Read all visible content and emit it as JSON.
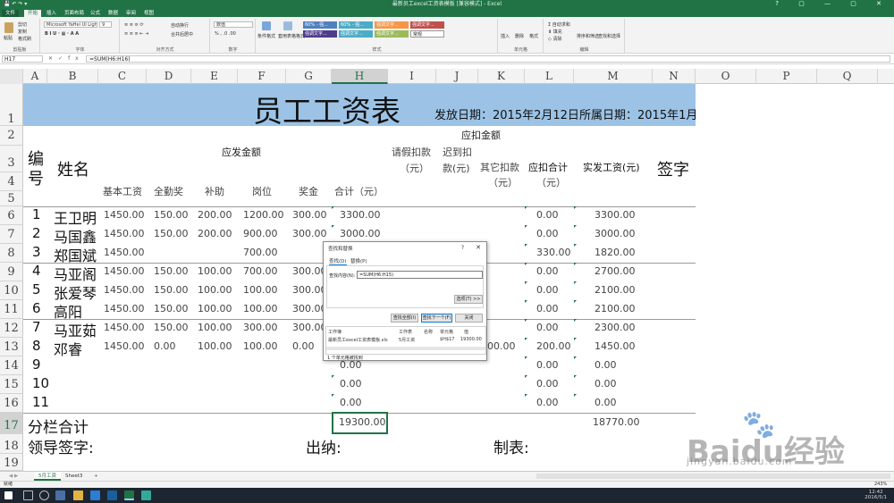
{
  "window": {
    "title": "最新员工excel工资表模板 [兼容模式] - Excel",
    "controls": "? ▢ — ▢ ✕"
  },
  "ribbon_tabs": [
    "文件",
    "开始",
    "插入",
    "页面布局",
    "公式",
    "数据",
    "审阅",
    "视图"
  ],
  "ribbon": {
    "clipboard": {
      "cut": "剪切",
      "copy": "复制",
      "paint": "格式刷",
      "paste": "粘贴",
      "label": "剪贴板"
    },
    "font": {
      "name": "Microsoft YaHei UI Ligh",
      "size": "9",
      "label": "字体"
    },
    "align": {
      "wrap": "自动换行",
      "merge": "合并后居中",
      "label": "对齐方式"
    },
    "number": {
      "format": "数值",
      "label": "数字"
    },
    "styles": {
      "cond": "条件格式",
      "table": "套用表格格式",
      "items": [
        {
          "text": "60% - 强...",
          "color": "#4f81bd"
        },
        {
          "text": "60% - 强...",
          "color": "#4bacc6"
        },
        {
          "text": "强调文字...",
          "color": "#f79646"
        },
        {
          "text": "强调文字...",
          "color": "#c0504d"
        },
        {
          "text": "强调文字...",
          "color": "#4f3d8c"
        },
        {
          "text": "强调文字...",
          "color": "#8064a2"
        },
        {
          "text": "强调文字...",
          "color": "#4bacc6"
        },
        {
          "text": "强调文字...",
          "color": "#9bbb59"
        },
        {
          "text": "强调文字...",
          "color": "#8064a2"
        },
        {
          "text": "常规",
          "color": "#ffffff"
        }
      ],
      "label": "样式"
    },
    "cells": {
      "insert": "插入",
      "delete": "删除",
      "format": "格式",
      "label": "单元格"
    },
    "edit": {
      "autosum": "自动求和",
      "fill": "填充",
      "clear": "清除",
      "sort": "排序和筛选",
      "find": "查找和选择",
      "label": "编辑"
    }
  },
  "formula_bar": {
    "name_box": "H17",
    "fx": "fx",
    "formula": "=SUM(H6:H16)"
  },
  "columns": [
    "A",
    "B",
    "C",
    "D",
    "E",
    "F",
    "G",
    "H",
    "I",
    "J",
    "K",
    "L",
    "M",
    "N",
    "O",
    "P",
    "Q"
  ],
  "rows": [
    "1",
    "2",
    "3",
    "4",
    "5",
    "6",
    "7",
    "8",
    "9",
    "10",
    "11",
    "12",
    "13",
    "14",
    "15",
    "16",
    "17",
    "18",
    "19"
  ],
  "sheet": {
    "title": "员工工资表",
    "issue_date": "发放日期：2015年2月12日",
    "period": "所属日期：2015年1月",
    "group_pay": "应发金额",
    "group_deduct": "应扣金额",
    "h_id": [
      "编",
      "号"
    ],
    "h_name": "姓名",
    "h_base": "基本工资",
    "h_attend": "全勤奖",
    "h_subsidy": "补助",
    "h_post": "岗位",
    "h_bonus": "奖金",
    "h_total": "合计（元）",
    "h_leave": [
      "请假扣款",
      "（元）"
    ],
    "h_late": [
      "迟到扣",
      "款(元)"
    ],
    "h_other": [
      "其它扣款",
      "（元）"
    ],
    "h_deduct": [
      "应扣合计",
      "（元）"
    ],
    "h_net": "实发工资(元)",
    "h_sign": "签字",
    "data": [
      {
        "id": "1",
        "name": "王卫明",
        "base": "1450.00",
        "attend": "150.00",
        "subsidy": "200.00",
        "post": "1200.00",
        "bonus": "300.00",
        "total": "3300.00",
        "other": "",
        "deduct": "0.00",
        "net": "3300.00"
      },
      {
        "id": "2",
        "name": "马国鑫",
        "base": "1450.00",
        "attend": "150.00",
        "subsidy": "200.00",
        "post": "900.00",
        "bonus": "300.00",
        "total": "3000.00",
        "other": "",
        "deduct": "0.00",
        "net": "3000.00"
      },
      {
        "id": "3",
        "name": "郑国斌",
        "base": "1450.00",
        "attend": "",
        "subsidy": "",
        "post": "700.00",
        "bonus": "",
        "total": "",
        "other": "",
        "deduct": "330.00",
        "net": "1820.00"
      },
      {
        "id": "4",
        "name": "马亚阁",
        "base": "1450.00",
        "attend": "150.00",
        "subsidy": "100.00",
        "post": "700.00",
        "bonus": "300.00",
        "total": "",
        "other": "",
        "deduct": "0.00",
        "net": "2700.00"
      },
      {
        "id": "5",
        "name": "张爱琴",
        "base": "1450.00",
        "attend": "150.00",
        "subsidy": "100.00",
        "post": "100.00",
        "bonus": "300.00",
        "total": "",
        "other": "",
        "deduct": "0.00",
        "net": "2100.00"
      },
      {
        "id": "6",
        "name": "高阳",
        "base": "1450.00",
        "attend": "150.00",
        "subsidy": "100.00",
        "post": "100.00",
        "bonus": "300.00",
        "total": "",
        "other": "",
        "deduct": "0.00",
        "net": "2100.00"
      },
      {
        "id": "7",
        "name": "马亚茹",
        "base": "1450.00",
        "attend": "150.00",
        "subsidy": "100.00",
        "post": "300.00",
        "bonus": "300.00",
        "total": "",
        "other": "",
        "deduct": "0.00",
        "net": "2300.00"
      },
      {
        "id": "8",
        "name": "邓睿",
        "base": "1450.00",
        "attend": "0.00",
        "subsidy": "100.00",
        "post": "100.00",
        "bonus": "0.00",
        "total": "",
        "other": "200.00",
        "deduct": "200.00",
        "net": "1450.00"
      },
      {
        "id": "9",
        "name": "",
        "base": "",
        "attend": "",
        "subsidy": "",
        "post": "",
        "bonus": "",
        "total": "0.00",
        "other": "",
        "deduct": "0.00",
        "net": "0.00"
      },
      {
        "id": "10",
        "name": "",
        "base": "",
        "attend": "",
        "subsidy": "",
        "post": "",
        "bonus": "",
        "total": "0.00",
        "other": "",
        "deduct": "0.00",
        "net": "0.00"
      },
      {
        "id": "11",
        "name": "",
        "base": "",
        "attend": "",
        "subsidy": "",
        "post": "",
        "bonus": "",
        "total": "0.00",
        "other": "",
        "deduct": "0.00",
        "net": "0.00"
      }
    ],
    "subtotal_label": "分栏合计",
    "subtotal_total": "19300.00",
    "subtotal_net": "18770.00",
    "sign_leader": "领导签字:",
    "sign_cashier": "出纳:",
    "sign_maker": "制表:"
  },
  "dialog": {
    "title": "查找和替换",
    "help": "?",
    "close": "✕",
    "tab_find": "查找(D)",
    "tab_replace": "替换(P)",
    "find_label": "查找内容(N):",
    "find_value": "=SUM(H6:H15)",
    "options": "选项(T) >>",
    "find_all": "查找全部(I)",
    "find_next": "查找下一个(F)",
    "close_btn": "关闭",
    "result_headers": [
      "工作簿",
      "工作表",
      "名称",
      "单元格",
      "值"
    ],
    "result_row": [
      "最新员工excel工资表模板.xls",
      "5月工资",
      "",
      "$H$17",
      "19300.00"
    ],
    "status": "1 个单元格被找到"
  },
  "sheet_tabs": [
    "5月工资",
    "Sheet3",
    "+"
  ],
  "status_bar": {
    "left": "就绪",
    "zoom": "243%"
  },
  "clock": {
    "time": "12:42",
    "date": "2016/5/1"
  },
  "watermark": {
    "text": "Baidu经验",
    "url": "jingyan.baidu.com"
  }
}
